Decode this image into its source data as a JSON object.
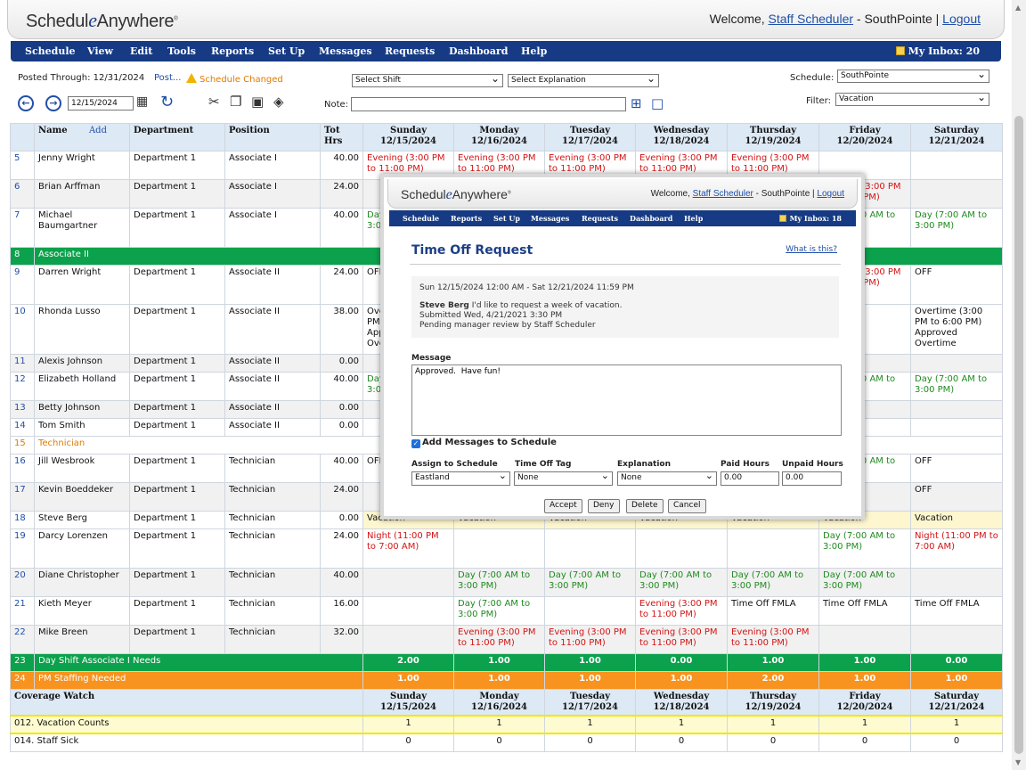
{
  "app": {
    "logo_a": "Schedul",
    "logo_e": "e",
    "logo_b": "Anywhere",
    "reg": "®"
  },
  "header": {
    "welcome": "Welcome,",
    "user": "Staff Scheduler",
    "sep": " - SouthPointe | ",
    "logout": "Logout"
  },
  "menu": [
    "Schedule",
    "View",
    "Edit",
    "Tools",
    "Reports",
    "Set Up",
    "Messages",
    "Requests",
    "Dashboard",
    "Help"
  ],
  "inbox": "My Inbox: 20",
  "toolbar": {
    "posted": "Posted Through: 12/31/2024",
    "post_link": "Post...",
    "changed": "Schedule Changed",
    "select_shift": "Select Shift",
    "select_explanation": "Select Explanation",
    "schedule_label": "Schedule:",
    "schedule_value": "SouthPointe",
    "filter_label": "Filter:",
    "filter_value": "Vacation",
    "date": "12/15/2024",
    "note_label": "Note:"
  },
  "grid": {
    "headers": {
      "name": "Name",
      "add": "Add",
      "department": "Department",
      "position": "Position",
      "tot": "Tot Hrs"
    },
    "days": [
      {
        "d": "Sunday",
        "date": "12/15/2024"
      },
      {
        "d": "Monday",
        "date": "12/16/2024"
      },
      {
        "d": "Tuesday",
        "date": "12/17/2024"
      },
      {
        "d": "Wednesday",
        "date": "12/18/2024"
      },
      {
        "d": "Thursday",
        "date": "12/19/2024"
      },
      {
        "d": "Friday",
        "date": "12/20/2024"
      },
      {
        "d": "Saturday",
        "date": "12/21/2024"
      }
    ],
    "rows": [
      {
        "n": "5",
        "name": "Jenny Wright",
        "dept": "Department 1",
        "pos": "Associate I",
        "hrs": "40.00",
        "cells": [
          [
            "Evening (3:00 PM to 11:00 PM)",
            "red"
          ],
          [
            "Evening (3:00 PM to 11:00 PM)",
            "red"
          ],
          [
            "Evening (3:00 PM to 11:00 PM)",
            "red"
          ],
          [
            "Evening (3:00 PM to 11:00 PM)",
            "red"
          ],
          [
            "Evening (3:00 PM to 11:00 PM)",
            "red"
          ],
          [
            "",
            ""
          ],
          [
            "",
            ""
          ]
        ]
      },
      {
        "n": "6",
        "name": "Brian Arffman",
        "dept": "Department 1",
        "pos": "Associate I",
        "hrs": "24.00",
        "alt": true,
        "cells": [
          [
            "",
            ""
          ],
          [
            "",
            ""
          ],
          [
            "",
            ""
          ],
          [
            "",
            ""
          ],
          [
            "",
            ""
          ],
          [
            "Evening (3:00 PM to 11:00 PM)",
            "red"
          ],
          [
            "",
            ""
          ]
        ]
      },
      {
        "n": "7",
        "name": "Michael Baumgartner",
        "dept": "Department 1",
        "pos": "Associate I",
        "hrs": "40.00",
        "tall": true,
        "cells": [
          [
            "Day (7:00 AM to 3:00 PM)",
            "grn"
          ],
          [
            "",
            ""
          ],
          [
            "",
            ""
          ],
          [
            "",
            ""
          ],
          [
            "",
            ""
          ],
          [
            "Day (7:00 AM to 3:00 PM)",
            "grn"
          ],
          [
            "Day (7:00 AM to 3:00 PM)",
            "grn"
          ]
        ]
      },
      {
        "group": "green",
        "n": "8",
        "label": "Associate II"
      },
      {
        "n": "9",
        "name": "Darren Wright",
        "dept": "Department 1",
        "pos": "Associate II",
        "hrs": "24.00",
        "tall": true,
        "cells": [
          [
            "OFF",
            ""
          ],
          [
            "",
            ""
          ],
          [
            "",
            ""
          ],
          [
            "",
            ""
          ],
          [
            "",
            ""
          ],
          [
            "Evening (3:00 PM to 11:00 PM)",
            "red"
          ],
          [
            "OFF",
            ""
          ]
        ]
      },
      {
        "n": "10",
        "name": "Rhonda Lusso",
        "dept": "Department 1",
        "pos": "Associate II",
        "hrs": "38.00",
        "taller": true,
        "cells": [
          [
            "Overtime (3:00 PM to 6:00 PM) Approved Overtime",
            ""
          ],
          [
            "",
            ""
          ],
          [
            "",
            ""
          ],
          [
            "",
            ""
          ],
          [
            "",
            ""
          ],
          [
            "",
            ""
          ],
          [
            "Overtime (3:00 PM to 6:00 PM) Approved Overtime",
            ""
          ]
        ]
      },
      {
        "n": "11",
        "name": "Alexis Johnson",
        "dept": "Department 1",
        "pos": "Associate II",
        "hrs": "0.00",
        "alt": true,
        "cells": [
          [
            "",
            ""
          ],
          [
            "",
            ""
          ],
          [
            "",
            ""
          ],
          [
            "",
            ""
          ],
          [
            "",
            ""
          ],
          [
            "",
            ""
          ],
          [
            "",
            ""
          ]
        ]
      },
      {
        "n": "12",
        "name": "Elizabeth Holland",
        "dept": "Department 1",
        "pos": "Associate II",
        "hrs": "40.00",
        "cells": [
          [
            "Day (7:00 AM to 3:00 PM)",
            "grn"
          ],
          [
            "",
            ""
          ],
          [
            "",
            ""
          ],
          [
            "",
            ""
          ],
          [
            "",
            ""
          ],
          [
            "Day (7:00 AM to 3:00 PM)",
            "grn"
          ],
          [
            "Day (7:00 AM to 3:00 PM)",
            "grn"
          ]
        ]
      },
      {
        "n": "13",
        "name": "Betty Johnson",
        "dept": "Department 1",
        "pos": "Associate II",
        "hrs": "0.00",
        "alt": true,
        "cells": [
          [
            "",
            ""
          ],
          [
            "",
            ""
          ],
          [
            "",
            ""
          ],
          [
            "",
            ""
          ],
          [
            "",
            ""
          ],
          [
            "",
            ""
          ],
          [
            "",
            ""
          ]
        ]
      },
      {
        "n": "14",
        "name": "Tom Smith",
        "dept": "Department 1",
        "pos": "Associate II",
        "hrs": "0.00",
        "cells": [
          [
            "",
            ""
          ],
          [
            "",
            ""
          ],
          [
            "",
            ""
          ],
          [
            "",
            ""
          ],
          [
            "",
            ""
          ],
          [
            "",
            ""
          ],
          [
            "",
            ""
          ]
        ]
      },
      {
        "group": "orange",
        "n": "15",
        "label": "Technician"
      },
      {
        "n": "16",
        "name": "Jill Wesbrook",
        "dept": "Department 1",
        "pos": "Technician",
        "hrs": "40.00",
        "cells": [
          [
            "OFF",
            ""
          ],
          [
            "",
            ""
          ],
          [
            "",
            ""
          ],
          [
            "",
            ""
          ],
          [
            "",
            ""
          ],
          [
            "Day (7:00 AM to 3:00 PM)",
            "grn"
          ],
          [
            "OFF",
            ""
          ]
        ]
      },
      {
        "n": "17",
        "name": "Kevin Boeddeker",
        "dept": "Department 1",
        "pos": "Technician",
        "hrs": "24.00",
        "alt": true,
        "cells": [
          [
            "",
            ""
          ],
          [
            "",
            ""
          ],
          [
            "",
            ""
          ],
          [
            "",
            ""
          ],
          [
            "",
            ""
          ],
          [
            "",
            ""
          ],
          [
            "OFF",
            ""
          ]
        ]
      },
      {
        "n": "18",
        "name": "Steve Berg",
        "dept": "Department 1",
        "pos": "Technician",
        "hrs": "0.00",
        "vac": true,
        "cells": [
          [
            "Vacation",
            ""
          ],
          [
            "Vacation",
            ""
          ],
          [
            "Vacation",
            ""
          ],
          [
            "Vacation",
            ""
          ],
          [
            "Vacation",
            ""
          ],
          [
            "Vacation",
            ""
          ],
          [
            "Vacation",
            ""
          ]
        ]
      },
      {
        "n": "19",
        "name": "Darcy Lorenzen",
        "dept": "Department 1",
        "pos": "Technician",
        "hrs": "24.00",
        "tall": true,
        "cells": [
          [
            "Night (11:00 PM to 7:00 AM)",
            "red"
          ],
          [
            "",
            ""
          ],
          [
            "",
            ""
          ],
          [
            "",
            ""
          ],
          [
            "",
            ""
          ],
          [
            "Day (7:00 AM to 3:00 PM)",
            "grn"
          ],
          [
            "Night (11:00 PM to 7:00 AM)",
            "red"
          ]
        ]
      },
      {
        "n": "20",
        "name": "Diane Christopher",
        "dept": "Department 1",
        "pos": "Technician",
        "hrs": "40.00",
        "alt": true,
        "cells": [
          [
            "",
            ""
          ],
          [
            "Day (7:00 AM to 3:00 PM)",
            "grn"
          ],
          [
            "Day (7:00 AM to 3:00 PM)",
            "grn"
          ],
          [
            "Day (7:00 AM to 3:00 PM)",
            "grn"
          ],
          [
            "Day (7:00 AM to 3:00 PM)",
            "grn"
          ],
          [
            "Day (7:00 AM to 3:00 PM)",
            "grn"
          ],
          [
            "",
            ""
          ]
        ]
      },
      {
        "n": "21",
        "name": "Kieth Meyer",
        "dept": "Department 1",
        "pos": "Technician",
        "hrs": "16.00",
        "cells": [
          [
            "",
            ""
          ],
          [
            "Day (7:00 AM to 3:00 PM)",
            "grn"
          ],
          [
            "",
            ""
          ],
          [
            "Evening (3:00 PM to 11:00 PM)",
            "red"
          ],
          [
            "Time Off FMLA",
            ""
          ],
          [
            "Time Off FMLA",
            ""
          ],
          [
            "Time Off FMLA",
            ""
          ]
        ]
      },
      {
        "n": "22",
        "name": "Mike Breen",
        "dept": "Department 1",
        "pos": "Technician",
        "hrs": "32.00",
        "alt": true,
        "cells": [
          [
            "",
            ""
          ],
          [
            "Evening (3:00 PM to 11:00 PM)",
            "red"
          ],
          [
            "Evening (3:00 PM to 11:00 PM)",
            "red"
          ],
          [
            "Evening (3:00 PM to 11:00 PM)",
            "red"
          ],
          [
            "Evening (3:00 PM to 11:00 PM)",
            "red"
          ],
          [
            "",
            ""
          ],
          [
            "",
            ""
          ]
        ]
      },
      {
        "sum": "green",
        "n": "23",
        "label": "Day Shift Associate I Needs",
        "vals": [
          "2.00",
          "1.00",
          "1.00",
          "0.00",
          "1.00",
          "1.00",
          "0.00"
        ]
      },
      {
        "sum": "orange",
        "n": "24",
        "label": "PM Staffing Needed",
        "vals": [
          "1.00",
          "1.00",
          "1.00",
          "1.00",
          "2.00",
          "1.00",
          "1.00"
        ]
      }
    ],
    "coverage_title": "Coverage Watch",
    "coverage": [
      {
        "label": "012. Vacation Counts",
        "vals": [
          "1",
          "1",
          "1",
          "1",
          "1",
          "1",
          "1"
        ],
        "yellow": true
      },
      {
        "label": "014. Staff Sick",
        "vals": [
          "0",
          "0",
          "0",
          "0",
          "0",
          "0",
          "0"
        ]
      }
    ]
  },
  "modal": {
    "logo_a": "Schedul",
    "logo_e": "e",
    "logo_b": "Anywhere",
    "reg": "®",
    "welcome": "Welcome,",
    "user": "Staff Scheduler",
    "sep": " - SouthPointe | ",
    "logout": "Logout",
    "menu": [
      "Schedule",
      "Reports",
      "Set Up",
      "Messages",
      "Requests",
      "Dashboard",
      "Help"
    ],
    "inbox": "My Inbox: 18",
    "title": "Time Off Request",
    "what": "What is this?",
    "range": "Sun 12/15/2024 12:00 AM - Sat 12/21/2024 11:59 PM",
    "requester": "Steve Berg",
    "request_text": " I'd like to request a week of vacation.",
    "submitted": "Submitted Wed, 4/21/2021 3:30 PM",
    "pending": "Pending manager review by Staff Scheduler",
    "message_label": "Message",
    "message": "Approved.  Have fun!",
    "add_messages": "Add Messages to Schedule",
    "labels": {
      "assign": "Assign to Schedule",
      "tag": "Time Off Tag",
      "explanation": "Explanation",
      "paid": "Paid Hours",
      "unpaid": "Unpaid Hours"
    },
    "values": {
      "assign": "Eastland",
      "tag": "None",
      "explanation": "None",
      "paid": "0.00",
      "unpaid": "0.00"
    },
    "buttons": {
      "accept": "Accept",
      "deny": "Deny",
      "delete": "Delete",
      "cancel": "Cancel"
    }
  }
}
